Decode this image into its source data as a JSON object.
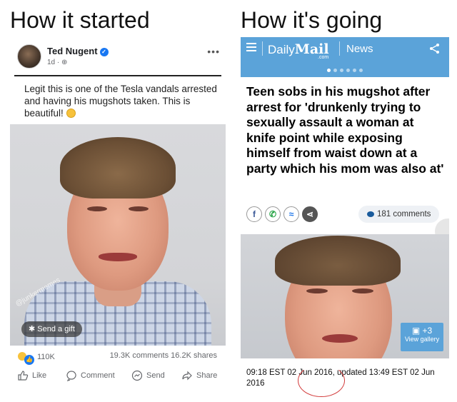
{
  "headings": {
    "left": "How it started",
    "right": "How it's going"
  },
  "facebook_post": {
    "author": "Ted Nugent",
    "meta": "1d · ",
    "more": "•••",
    "text": "Legit this is one of the Tesla vandals arrested and having his mugshots taken. This is beautiful!",
    "watermark": "@junkermemes",
    "gift_label": "Send a gift",
    "reaction_count": "110K",
    "comments": "19.3K comments",
    "shares": "16.2K shares",
    "actions": {
      "like": "Like",
      "comment": "Comment",
      "send": "Send",
      "share": "Share"
    },
    "colors": {
      "accent": "#1877f2"
    }
  },
  "daily_mail": {
    "logo": "Daily",
    "logo_bold": "Mail",
    "logo_com": ".com",
    "section": "News",
    "headline": "Teen sobs in his mugshot after arrest for 'drunkenly trying to sexually assault a woman at knife point while exposing himself from waist down at a party which his mom was also at'",
    "comments": "181 comments",
    "social_icons": [
      "facebook-icon",
      "whatsapp-icon",
      "messenger-icon",
      "share-icon"
    ],
    "gallery_count": "+3",
    "gallery_label": "View gallery",
    "timestamp": "09:18 EST 02 Jun 2016, updated 13:49 EST 02 Jun 2016",
    "colors": {
      "bar": "#5ba3d9",
      "annotation_circle": "#d23a3a"
    }
  }
}
